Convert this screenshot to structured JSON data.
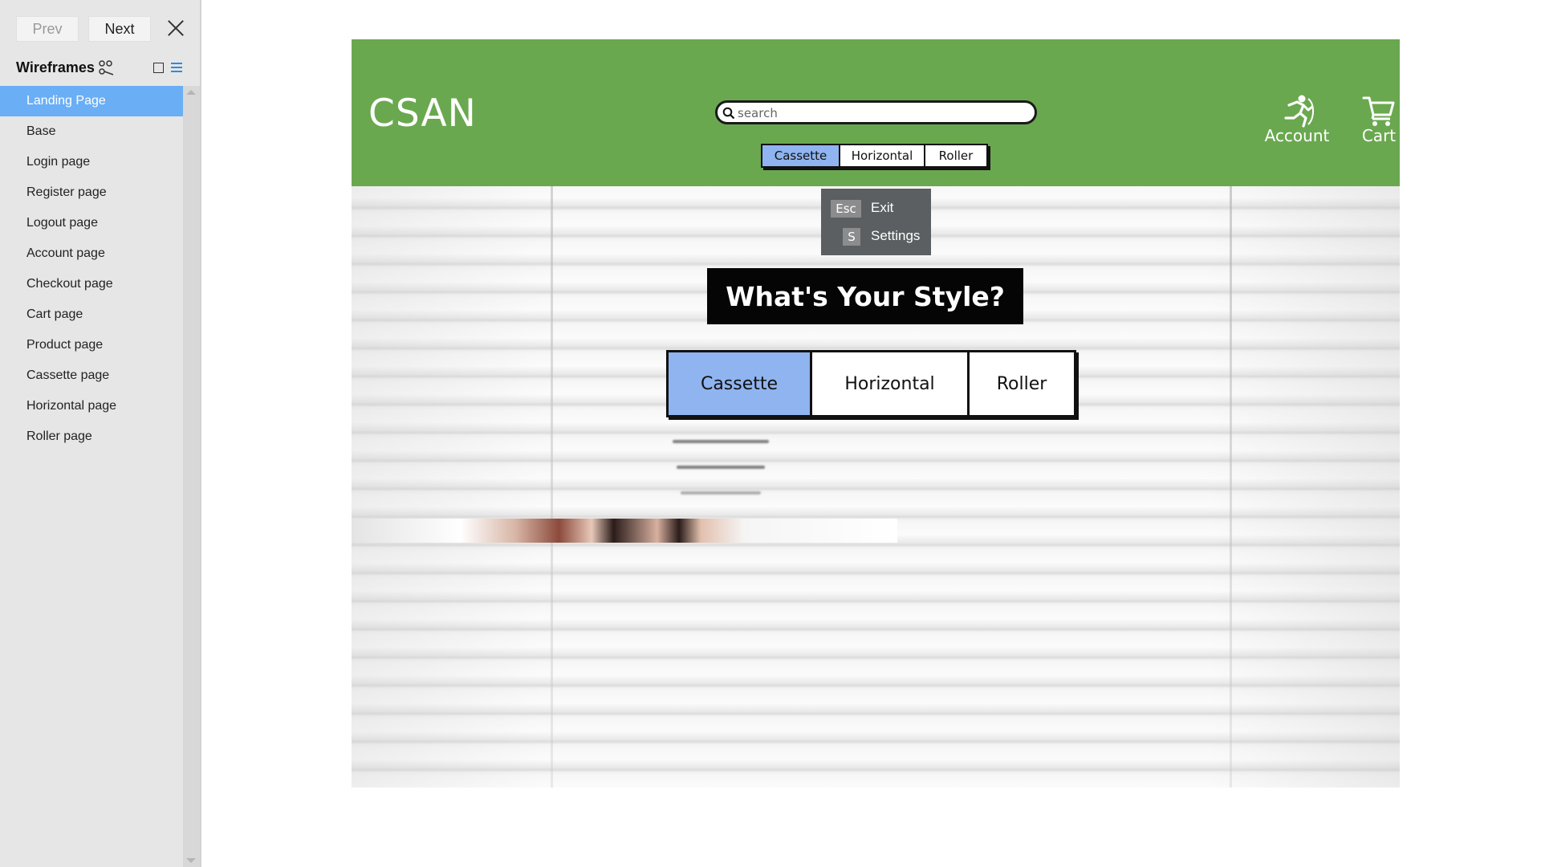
{
  "sidebar": {
    "prev_label": "Prev",
    "next_label": "Next",
    "title": "Wireframes",
    "pages": [
      {
        "label": "Landing Page",
        "active": true
      },
      {
        "label": "Base"
      },
      {
        "label": "Login page"
      },
      {
        "label": "Register page"
      },
      {
        "label": "Logout page"
      },
      {
        "label": "Account page"
      },
      {
        "label": "Checkout page"
      },
      {
        "label": "Cart page"
      },
      {
        "label": "Product page"
      },
      {
        "label": "Cassette page"
      },
      {
        "label": "Horizontal page"
      },
      {
        "label": "Roller page"
      }
    ]
  },
  "site": {
    "logo": "CSAN",
    "search_placeholder": "search",
    "header_tabs": [
      "Cassette",
      "Horizontal",
      "Roller"
    ],
    "header_active_tab": "Cassette",
    "account_label": "Account",
    "cart_label": "Cart",
    "banner": "What's Your Style?",
    "style_tabs": [
      "Cassette",
      "Horizontal",
      "Roller"
    ],
    "style_active_tab": "Cassette"
  },
  "shortcut_popup": {
    "esc_key": "Esc",
    "exit_label": "Exit",
    "s_key": "S",
    "settings_label": "Settings"
  },
  "colors": {
    "header_green": "#6aa84f",
    "active_tab_blue": "#8fb4ef",
    "sidebar_active": "#6aaef5"
  },
  "icons": [
    "close-icon",
    "sitemap-icon",
    "square-view-icon",
    "list-view-icon",
    "search-icon",
    "running-person-icon",
    "cart-icon"
  ]
}
